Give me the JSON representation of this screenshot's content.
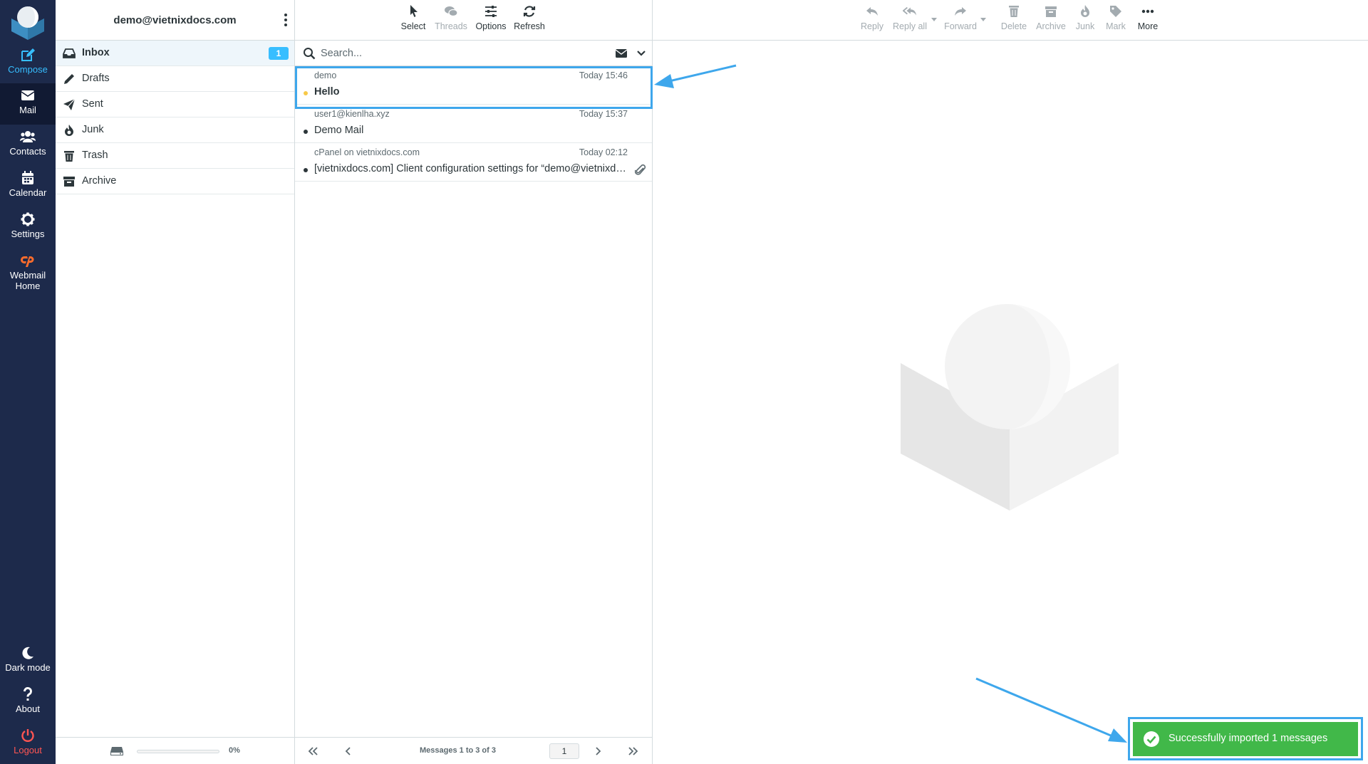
{
  "nav": {
    "compose": "Compose",
    "mail": "Mail",
    "contacts": "Contacts",
    "calendar": "Calendar",
    "settings": "Settings",
    "webmail_line1": "Webmail",
    "webmail_line2": "Home",
    "dark_mode": "Dark mode",
    "about": "About",
    "logout": "Logout"
  },
  "account": {
    "email": "demo@vietnixdocs.com"
  },
  "folders": [
    {
      "name": "Inbox",
      "icon": "inbox-icon",
      "unread": "1",
      "selected": true
    },
    {
      "name": "Drafts",
      "icon": "pencil-icon"
    },
    {
      "name": "Sent",
      "icon": "paper-plane-icon"
    },
    {
      "name": "Junk",
      "icon": "fire-icon"
    },
    {
      "name": "Trash",
      "icon": "trash-icon"
    },
    {
      "name": "Archive",
      "icon": "archive-box-icon"
    }
  ],
  "quota": {
    "percent_label": "0%",
    "used_fraction": 0
  },
  "list_toolbar": {
    "select": "Select",
    "threads": "Threads",
    "options": "Options",
    "refresh": "Refresh"
  },
  "search": {
    "placeholder": "Search..."
  },
  "messages": [
    {
      "from": "demo",
      "date": "Today 15:46",
      "subject": "Hello",
      "unread": true,
      "attachment": false
    },
    {
      "from": "user1@kienlha.xyz",
      "date": "Today 15:37",
      "subject": "Demo Mail",
      "unread": false,
      "attachment": false
    },
    {
      "from": "cPanel on vietnixdocs.com",
      "date": "Today 02:12",
      "subject": "[vietnixdocs.com] Client configuration settings for “demo@vietnixdocs.com”",
      "unread": false,
      "attachment": true
    }
  ],
  "pagination": {
    "count_text": "Messages 1 to 3 of 3",
    "page": "1"
  },
  "content_toolbar": {
    "reply": "Reply",
    "reply_all": "Reply all",
    "forward": "Forward",
    "delete": "Delete",
    "archive": "Archive",
    "junk": "Junk",
    "mark": "Mark",
    "more": "More"
  },
  "toast": {
    "message": "Successfully imported 1 messages"
  },
  "colors": {
    "nav_bg": "#1d2a4b",
    "accent": "#37beff",
    "success": "#41b849",
    "annotation": "#3ea7ec",
    "logout": "#ff5552"
  }
}
